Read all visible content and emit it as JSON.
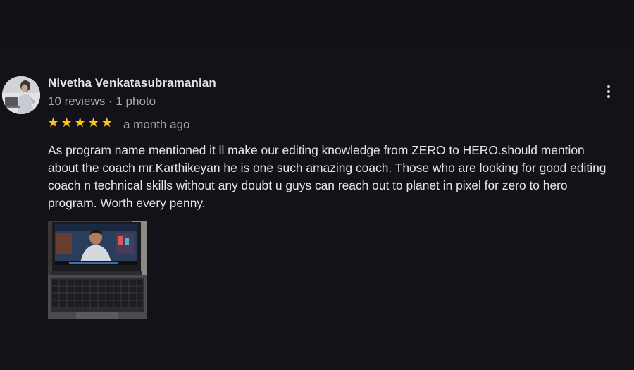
{
  "review": {
    "reviewer_name": "Nivetha Venkatasubramanian",
    "reviewer_meta": "10 reviews · 1 photo",
    "rating": 5,
    "stars": [
      "★",
      "★",
      "★",
      "★",
      "★"
    ],
    "date": "a month ago",
    "text_lines": [
      "As program name mentioned it ll make our editing knowledge from ZERO to HERO.should mention",
      "about the coach mr.Karthikeyan he is one such amazing coach.  Those who are looking for good editing",
      "coach n technical skills without any doubt u guys can reach out to planet in pixel for zero to hero",
      "program. Worth every penny."
    ],
    "photo_count": 1
  },
  "icons": {
    "more": "more-vert-icon",
    "star": "star-icon"
  },
  "colors": {
    "background": "#131218",
    "star": "#f7c31c",
    "text_primary": "#e6e6ea",
    "text_secondary": "#a7a6ad"
  }
}
